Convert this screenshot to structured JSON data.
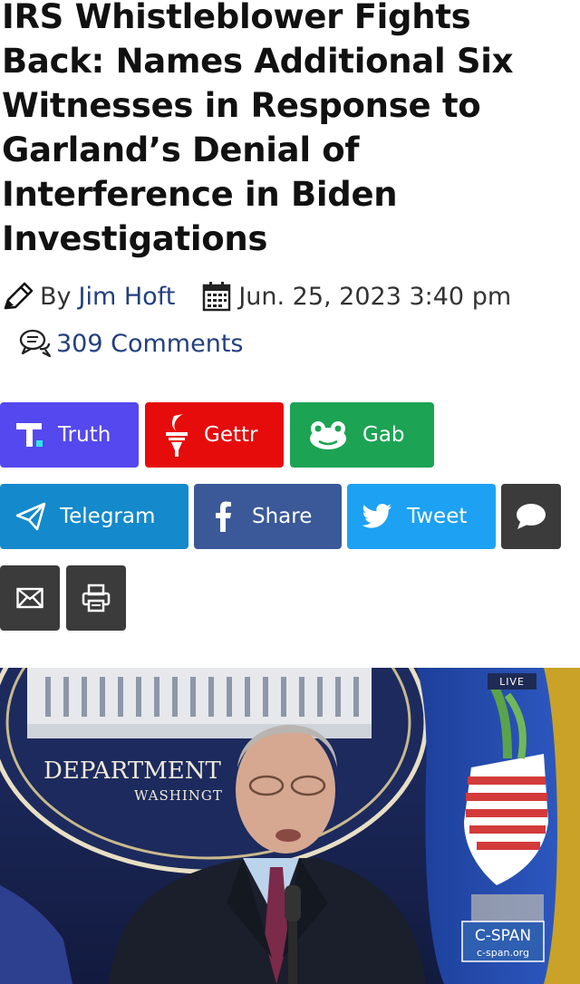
{
  "article": {
    "title": "IRS Whistleblower Fights Back: Names Additional Six Witnesses in Response to Garland’s Denial of Interference in Biden Investigations",
    "byline_prefix": "By",
    "author": "Jim Hoft",
    "date": "Jun. 25, 2023 3:40 pm",
    "comments": "309 Comments"
  },
  "share": {
    "truth": "Truth",
    "gettr": "Gettr",
    "gab": "Gab",
    "telegram": "Telegram",
    "facebook": "Share",
    "twitter": "Tweet"
  },
  "icons": {
    "author": "pencil-icon",
    "date": "calendar-icon",
    "comments": "speech-bubbles-icon",
    "sms": "chat-bubble-icon",
    "email": "envelope-icon",
    "print": "printer-icon"
  },
  "colors": {
    "truth": "#5448ee",
    "gettr": "#e60c0c",
    "gab": "#1ca353",
    "telegram": "#1489cc",
    "facebook": "#3b5998",
    "twitter": "#1da1f2",
    "dark": "#3b3b3b",
    "link": "#23407e"
  },
  "photo": {
    "seal_text_1": "DEPARTMENT",
    "seal_text_2": "WASHINGT",
    "live_badge": "LIVE",
    "network_logo": "C-SPAN",
    "network_url": "c-span.org"
  }
}
